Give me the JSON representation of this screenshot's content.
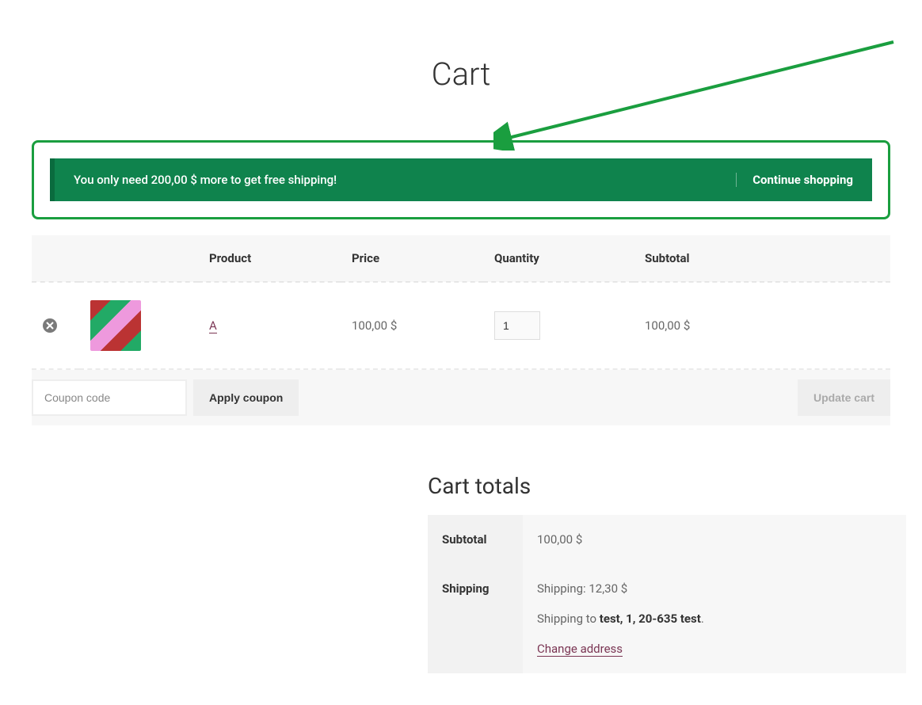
{
  "page": {
    "title": "Cart"
  },
  "notice": {
    "message": "You only need 200,00 $ more to get free shipping!",
    "action_label": "Continue shopping"
  },
  "table": {
    "headers": {
      "product": "Product",
      "price": "Price",
      "quantity": "Quantity",
      "subtotal": "Subtotal"
    }
  },
  "items": [
    {
      "name": "A",
      "price": "100,00 $",
      "qty": "1",
      "subtotal": "100,00 $"
    }
  ],
  "coupon": {
    "placeholder": "Coupon code",
    "apply_label": "Apply coupon"
  },
  "update_cart_label": "Update cart",
  "totals": {
    "title": "Cart totals",
    "subtotal_label": "Subtotal",
    "subtotal_value": "100,00 $",
    "shipping_label": "Shipping",
    "shipping_line": "Shipping: 12,30 $",
    "shipping_to_prefix": "Shipping to ",
    "shipping_to_bold": "test, 1, 20-635 test",
    "shipping_to_suffix": ".",
    "change_address": "Change address"
  }
}
